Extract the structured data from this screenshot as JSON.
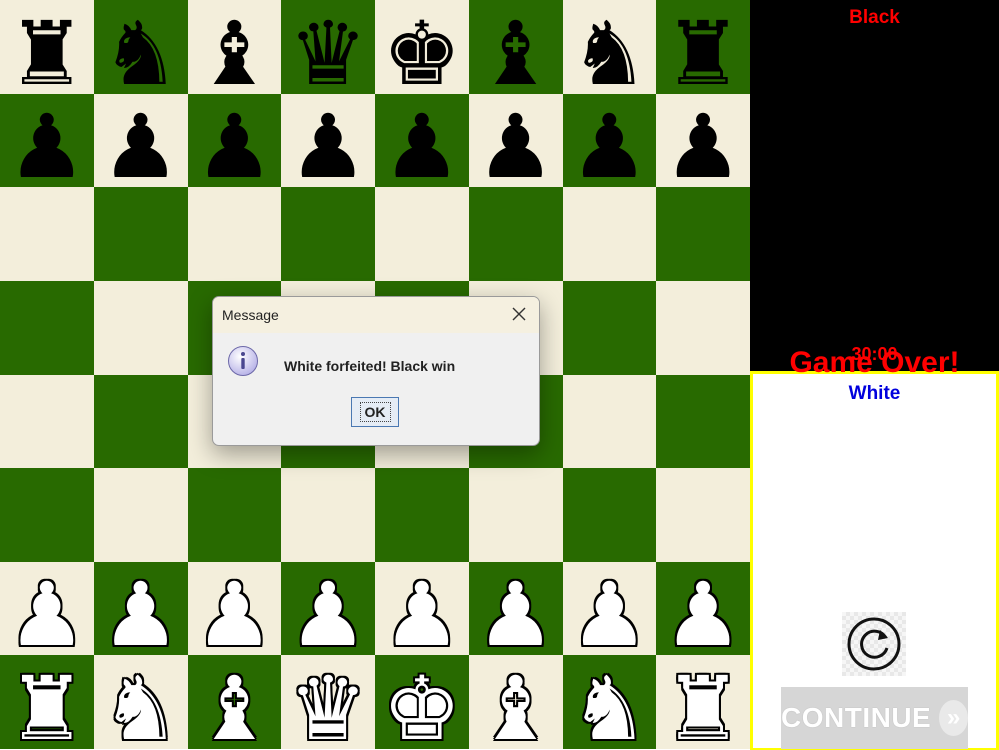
{
  "colors": {
    "light_square": "#f3eedb",
    "dark_square": "#286a00",
    "black_panel": "#000000",
    "white_panel_border": "#ffff00",
    "status_red": "#ff0000",
    "white_label_blue": "#0000dd"
  },
  "board": {
    "ranks": [
      [
        "br",
        "bn",
        "bb",
        "bq",
        "bk",
        "bb",
        "bn",
        "br"
      ],
      [
        "bp",
        "bp",
        "bp",
        "bp",
        "bp",
        "bp",
        "bp",
        "bp"
      ],
      [
        "",
        "",
        "",
        "",
        "",
        "",
        "",
        ""
      ],
      [
        "",
        "",
        "",
        "",
        "",
        "",
        "",
        ""
      ],
      [
        "",
        "",
        "",
        "",
        "",
        "",
        "",
        ""
      ],
      [
        "",
        "",
        "",
        "",
        "",
        "",
        "",
        ""
      ],
      [
        "wp",
        "wp",
        "wp",
        "wp",
        "wp",
        "wp",
        "wp",
        "wp"
      ],
      [
        "wr",
        "wn",
        "wb",
        "wq",
        "wk",
        "wb",
        "wn",
        "wr"
      ]
    ],
    "piece_icons": {
      "k": "king-icon",
      "q": "queen-icon",
      "r": "rook-icon",
      "b": "bishop-icon",
      "n": "knight-icon",
      "p": "pawn-icon"
    }
  },
  "sidebar": {
    "black_label": "Black",
    "black_timer": "30:00",
    "status": "Game Over!",
    "white_label": "White",
    "restart_icon": "restart-icon",
    "continue_label": "CONTINUE",
    "continue_icon": "double-chevron-right-icon"
  },
  "dialog": {
    "title": "Message",
    "message": "White forfeited! Black win",
    "ok_label": "OK",
    "icon": "info-icon",
    "close_icon": "close-icon"
  }
}
